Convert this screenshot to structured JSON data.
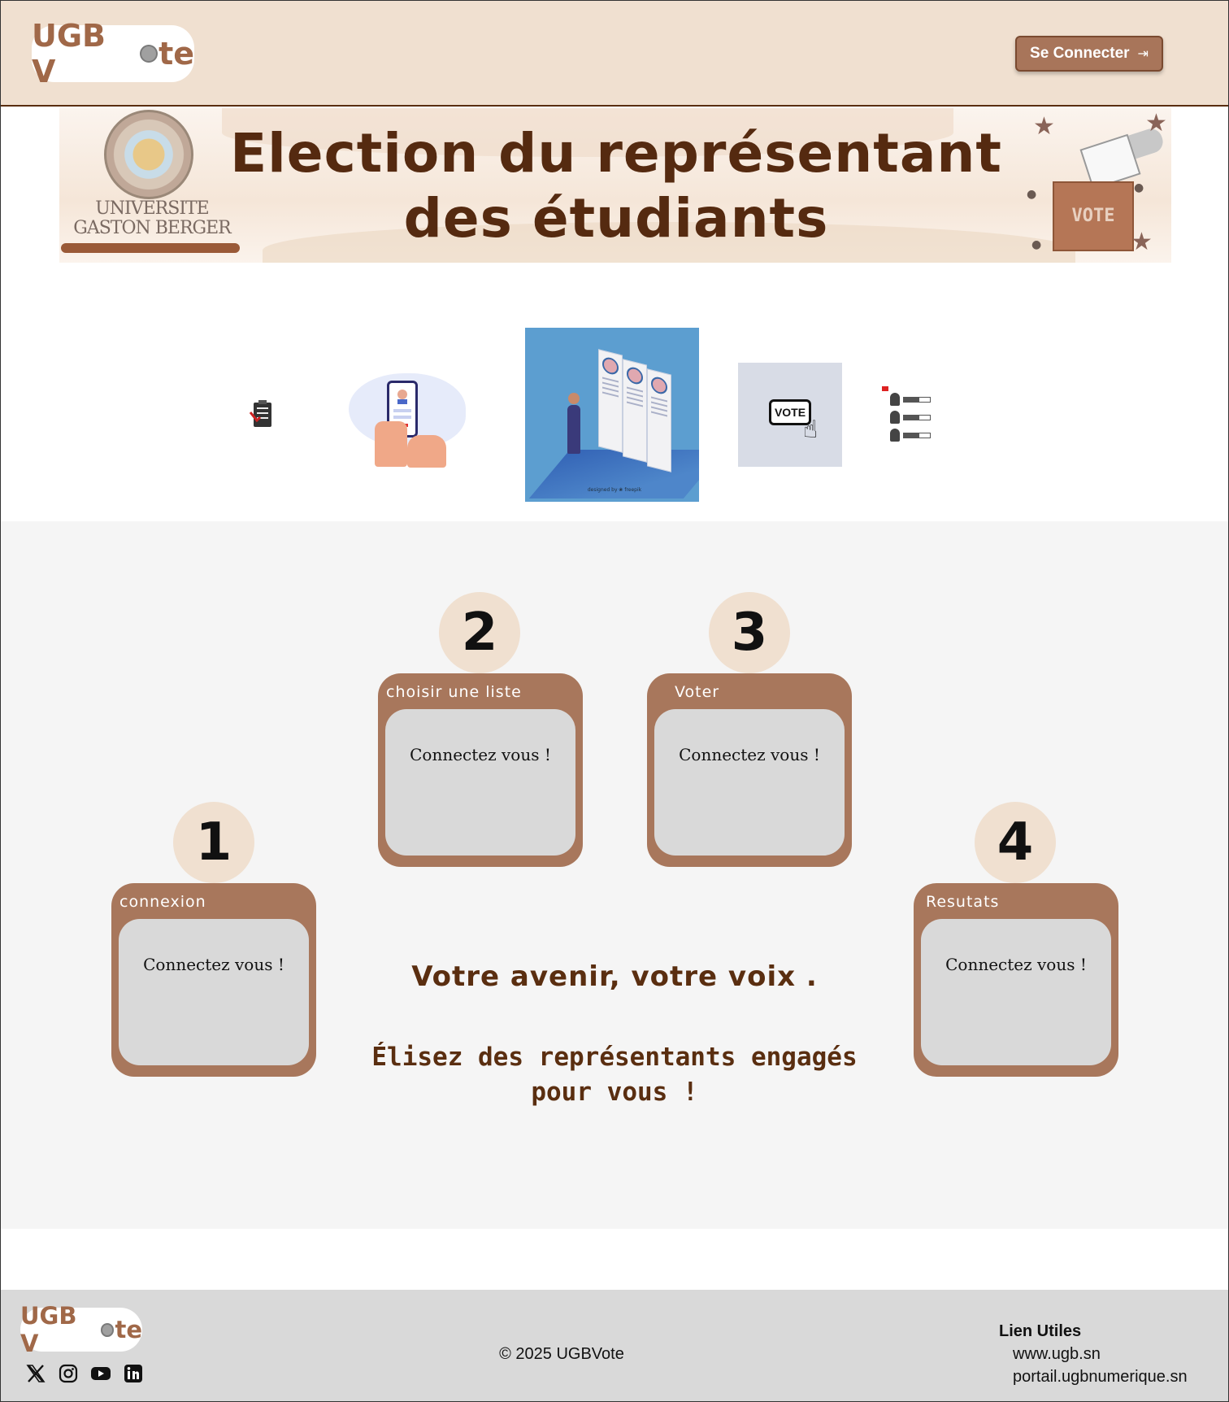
{
  "header": {
    "logo": {
      "prefix": "UGB V",
      "o": "",
      "suffix": "te"
    },
    "connect_label": "Se Connecter",
    "connect_icon": "login-arrow-icon"
  },
  "banner": {
    "title": "Election du représentant des étudiants",
    "university_name": "UNIVERSITE GASTON BERGER",
    "ballot_label": "VOTE"
  },
  "icons": [
    {
      "name": "ballot-clipboard-icon"
    },
    {
      "name": "phone-vote-illustration"
    },
    {
      "name": "candidates-illustration",
      "credit": "designed by ❀ freepik"
    },
    {
      "name": "vote-click-illustration",
      "label": "VOTE"
    },
    {
      "name": "ranking-list-icon"
    }
  ],
  "steps": [
    {
      "number": "1",
      "title": "connexion",
      "text": "Connectez vous !"
    },
    {
      "number": "2",
      "title": "choisir une liste",
      "text": "Connectez vous !"
    },
    {
      "number": "3",
      "title": "Voter",
      "text": "Connectez vous !"
    },
    {
      "number": "4",
      "title": "Resutats",
      "text": "Connectez vous !"
    }
  ],
  "slogan": "Votre avenir, votre voix .",
  "tagline": "Élisez des représentants engagés pour vous !",
  "footer": {
    "logo": {
      "prefix": "UGB V",
      "suffix": "te"
    },
    "socials": [
      "x-icon",
      "instagram-icon",
      "youtube-icon",
      "linkedin-icon"
    ],
    "copyright": "© 2025 UGBVote",
    "links_title": "Lien Utiles",
    "links": [
      "www.ugb.sn",
      "portail.ugbnumerique.sn"
    ]
  },
  "colors": {
    "header_bg": "#f0e0d0",
    "accent_brown": "#a8775c",
    "dark_brown": "#5a2e10",
    "step_inner": "#d9d9d9",
    "footer_bg": "#d9d9d9"
  }
}
